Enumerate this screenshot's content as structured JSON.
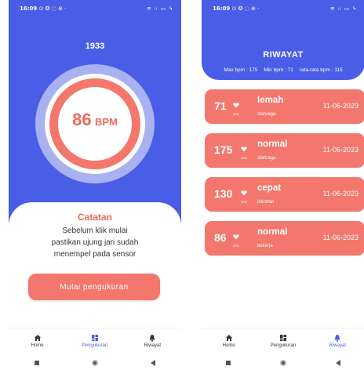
{
  "colors": {
    "primary": "#4a5de6",
    "accent": "#f3776c",
    "ring_light": "#a9b2f0"
  },
  "status_bar": {
    "left": {
      "time": "16:09",
      "icons": "⊙ ✪ ◌ ⊛ ·"
    },
    "right": {
      "time": "16:09",
      "icons": "⊙ ✪ ◌ ⊛ ·"
    },
    "system_icons": "≋ ᵢₗ ▭ ϟ"
  },
  "measure": {
    "counter": "1933",
    "bpm_value": "86",
    "bpm_unit": "BPM",
    "note_title": "Catatan",
    "note_lines": [
      "Sebelum klik mulai",
      "pastikan ujung jari sudah",
      "menempel pada sensor"
    ],
    "start_button": "Mulai pengukuran"
  },
  "nav": {
    "home": "Home",
    "measure": "Pengukuran",
    "history": "Riwayat"
  },
  "history": {
    "title": "RIWAYAT",
    "stats": [
      "Max bpm : 175",
      "Min bpm : 71",
      "rata-rata bpm : 115"
    ],
    "bpm_label": "BPM",
    "records": [
      {
        "bpm": "71",
        "status": "lemah",
        "activity": "olahraga",
        "date": "11-06-2023"
      },
      {
        "bpm": "175",
        "status": "normal",
        "activity": "olahraga",
        "date": "11-06-2023"
      },
      {
        "bpm": "130",
        "status": "cepat",
        "activity": "istirahat",
        "date": "11-06-2023"
      },
      {
        "bpm": "86",
        "status": "normal",
        "activity": "bekerja",
        "date": "11-06-2023"
      }
    ]
  }
}
